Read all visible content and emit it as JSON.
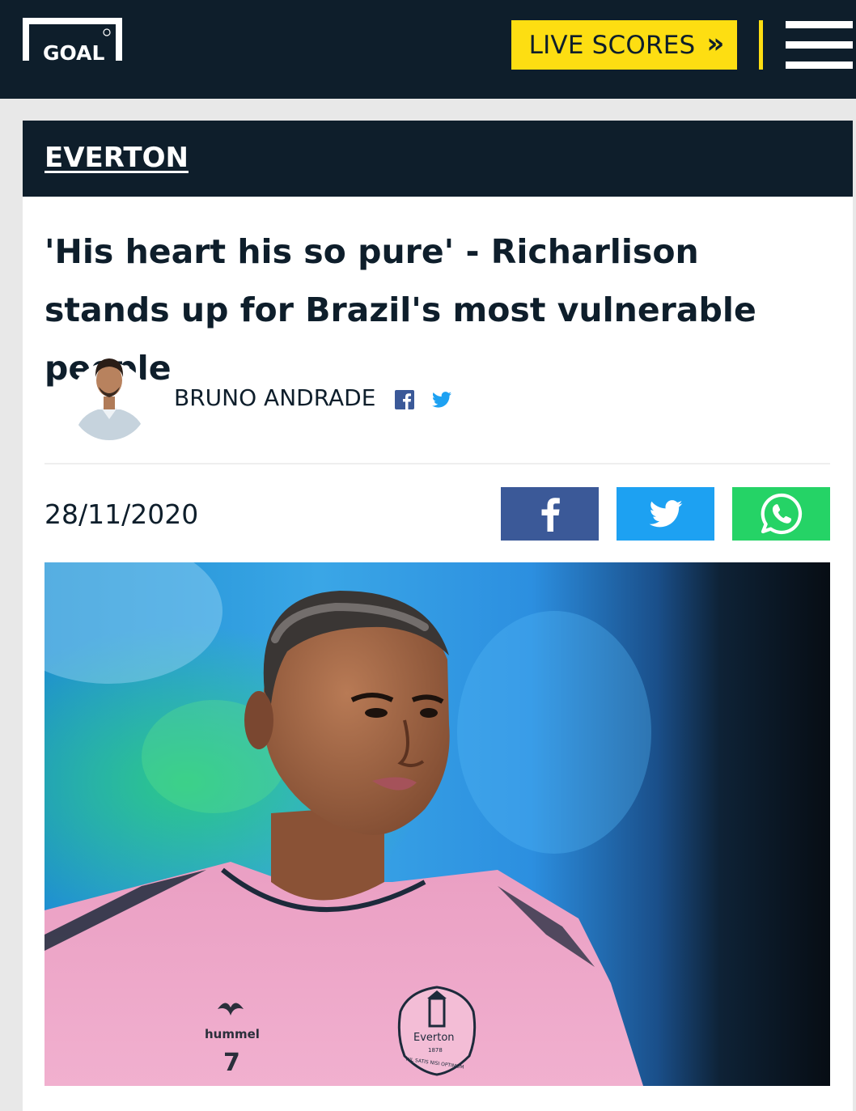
{
  "header": {
    "logo_text": "GOAL",
    "live_scores_label": "LIVE SCORES",
    "live_scores_chevron": "»"
  },
  "article": {
    "category": "EVERTON",
    "headline": "'His heart his so pure' - Richarlison stands up for Brazil's most vulnerable people",
    "author": "BRUNO ANDRADE",
    "date": "28/11/2020",
    "image_kit_brand": "hummel",
    "image_kit_number": "7",
    "image_crest_text": "Everton",
    "image_crest_year": "1878",
    "image_crest_motto": "NIL SATIS NISI OPTIMUM"
  },
  "colors": {
    "navy": "#0e1e2b",
    "yellow": "#fdde12",
    "facebook": "#3b5998",
    "twitter": "#1da1f2",
    "whatsapp": "#25d366"
  },
  "icons": [
    "facebook-icon",
    "twitter-icon",
    "whatsapp-icon",
    "menu-icon",
    "chevron-double-right-icon"
  ]
}
